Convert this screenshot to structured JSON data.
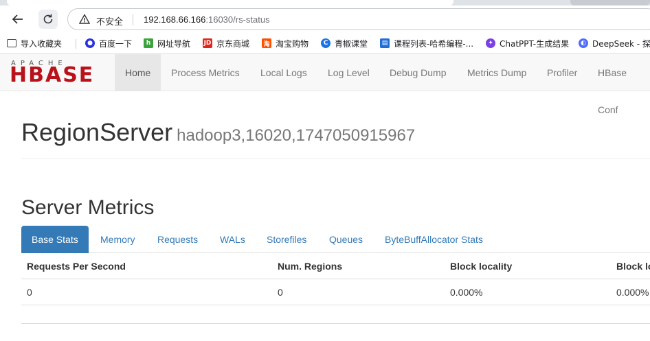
{
  "browser": {
    "insecure_label": "不安全",
    "url_host": "192.168.66.166",
    "url_rest": ":16030/rs-status"
  },
  "bookmarks": [
    {
      "label": "导入收藏夹",
      "icon": "folder-icon"
    },
    {
      "label": "百度一下",
      "icon": "baidu-icon",
      "color": "#2932e1"
    },
    {
      "label": "网址导航",
      "icon": "hao-icon",
      "color": "#3aa43a"
    },
    {
      "label": "京东商城",
      "icon": "jd-icon",
      "color": "#e1251b"
    },
    {
      "label": "淘宝购物",
      "icon": "taobao-icon",
      "color": "#ff5000"
    },
    {
      "label": "青椒课堂",
      "icon": "qingjiao-icon",
      "color": "#1a73e8"
    },
    {
      "label": "课程列表-哈希编程-...",
      "icon": "course-icon",
      "color": "#1e6ed8"
    },
    {
      "label": "ChatPPT-生成结果",
      "icon": "chatppt-icon",
      "color": "#7b3fe4"
    },
    {
      "label": "DeepSeek - 探索",
      "icon": "deepseek-icon",
      "color": "#4d6bfe"
    }
  ],
  "logo": {
    "apache": "APACHE",
    "hbase": "HBASE"
  },
  "nav": [
    {
      "label": "Home"
    },
    {
      "label": "Process Metrics"
    },
    {
      "label": "Local Logs"
    },
    {
      "label": "Log Level"
    },
    {
      "label": "Debug Dump"
    },
    {
      "label": "Metrics Dump"
    },
    {
      "label": "Profiler"
    },
    {
      "label": "HBase Conf"
    }
  ],
  "page": {
    "title": "RegionServer",
    "server_name": "hadoop3,16020,1747050915967",
    "section_title": "Server Metrics"
  },
  "tabs": [
    {
      "label": "Base Stats"
    },
    {
      "label": "Memory"
    },
    {
      "label": "Requests"
    },
    {
      "label": "WALs"
    },
    {
      "label": "Storefiles"
    },
    {
      "label": "Queues"
    },
    {
      "label": "ByteBuffAllocator Stats"
    }
  ],
  "table": {
    "headers": [
      "Requests Per Second",
      "Num. Regions",
      "Block locality",
      "Block lo"
    ],
    "rows": [
      [
        "0",
        "0",
        "0.000%",
        "0.000%"
      ]
    ]
  },
  "colors": {
    "accent": "#337ab7",
    "brand": "#b9121b"
  }
}
